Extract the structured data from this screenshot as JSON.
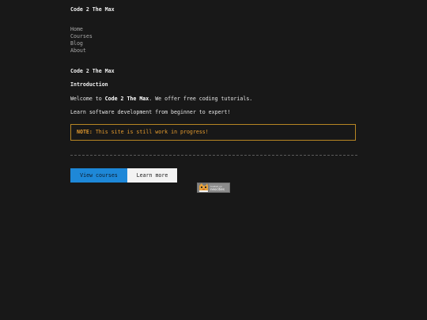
{
  "site": {
    "title": "Code 2 The Max"
  },
  "nav": {
    "items": [
      {
        "label": "Home"
      },
      {
        "label": "Courses"
      },
      {
        "label": "Blog"
      },
      {
        "label": "About"
      }
    ]
  },
  "main": {
    "page_heading": "Code 2 The Max",
    "section_heading": "Introduction",
    "para1_before": "Welcome to ",
    "para1_bold": "Code 2 The Max",
    "para1_after": ". We offer free coding tutorials.",
    "para2": "Learn software development from beginner to expert!",
    "notice_label": "NOTE:",
    "notice_text": " This site is still work in progress!"
  },
  "buttons": {
    "primary_label": "View courses",
    "secondary_label": "Learn more"
  },
  "badge": {
    "line1": "hosted on",
    "line2": "neocities"
  },
  "colors": {
    "background": "#181818",
    "accent": "#1e88d8",
    "notice": "#e39a2e"
  }
}
